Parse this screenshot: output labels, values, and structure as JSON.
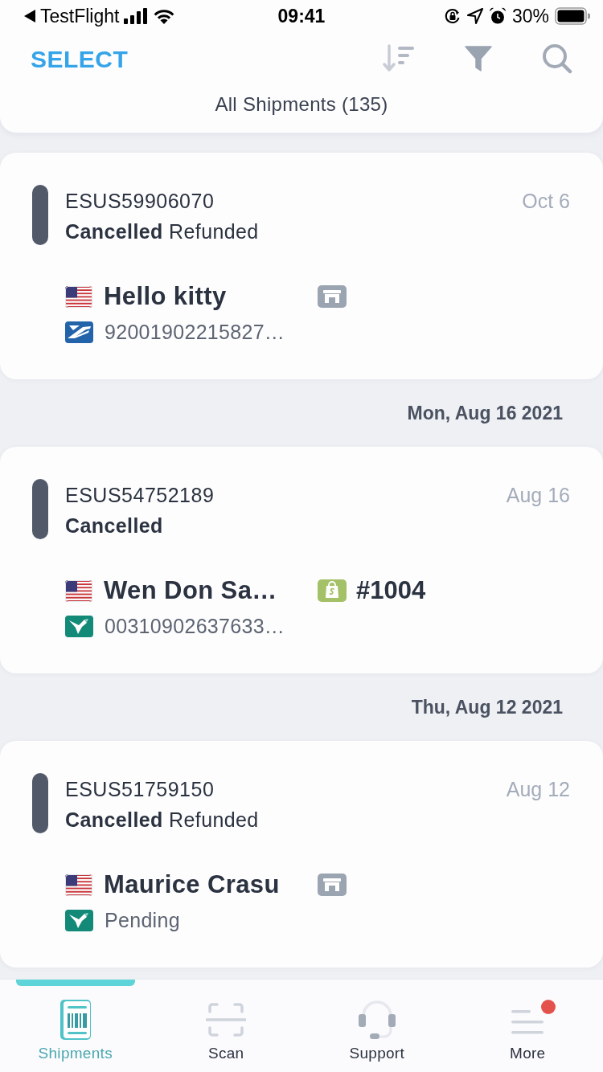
{
  "status_bar": {
    "back_label": "TestFlight",
    "time": "09:41",
    "battery": "30%"
  },
  "header": {
    "select": "SELECT",
    "title": "All Shipments (135)"
  },
  "items": [
    {
      "kind": "shipment",
      "id": "ESUS59906070",
      "status": "Cancelled",
      "sub_status": "Refunded",
      "date": "Oct 6",
      "color": "#525a6a",
      "recipient": "Hello kitty",
      "channel_icon": {
        "kind": "store"
      },
      "tracking": "92001902215827…",
      "carrier_icon": {
        "kind": "eagle"
      }
    },
    {
      "kind": "date_header",
      "label": "Mon, Aug 16 2021"
    },
    {
      "kind": "shipment",
      "id": "ESUS54752189",
      "status": "Cancelled",
      "date": "Aug 16",
      "color": "#525a6a",
      "recipient": "Wen Don Sa…",
      "channel_icon": {
        "kind": "bag"
      },
      "order": "#1004",
      "tracking": "00310902637633…",
      "carrier_icon": {
        "kind": "bird"
      }
    },
    {
      "kind": "date_header",
      "label": "Thu, Aug 12 2021"
    },
    {
      "kind": "shipment",
      "id": "ESUS51759150",
      "status": "Cancelled",
      "sub_status": "Refunded",
      "date": "Aug 12",
      "color": "#525a6a",
      "recipient": "Maurice Crasu",
      "channel_icon": {
        "kind": "store"
      },
      "tracking": "Pending",
      "carrier_icon": {
        "kind": "bird"
      }
    }
  ],
  "tabs": [
    {
      "label": "Shipments",
      "selected": true,
      "badge": false
    },
    {
      "label": "Scan",
      "selected": false,
      "badge": false
    },
    {
      "label": "Support",
      "selected": false,
      "badge": false
    },
    {
      "label": "More",
      "selected": false,
      "badge": true
    }
  ]
}
